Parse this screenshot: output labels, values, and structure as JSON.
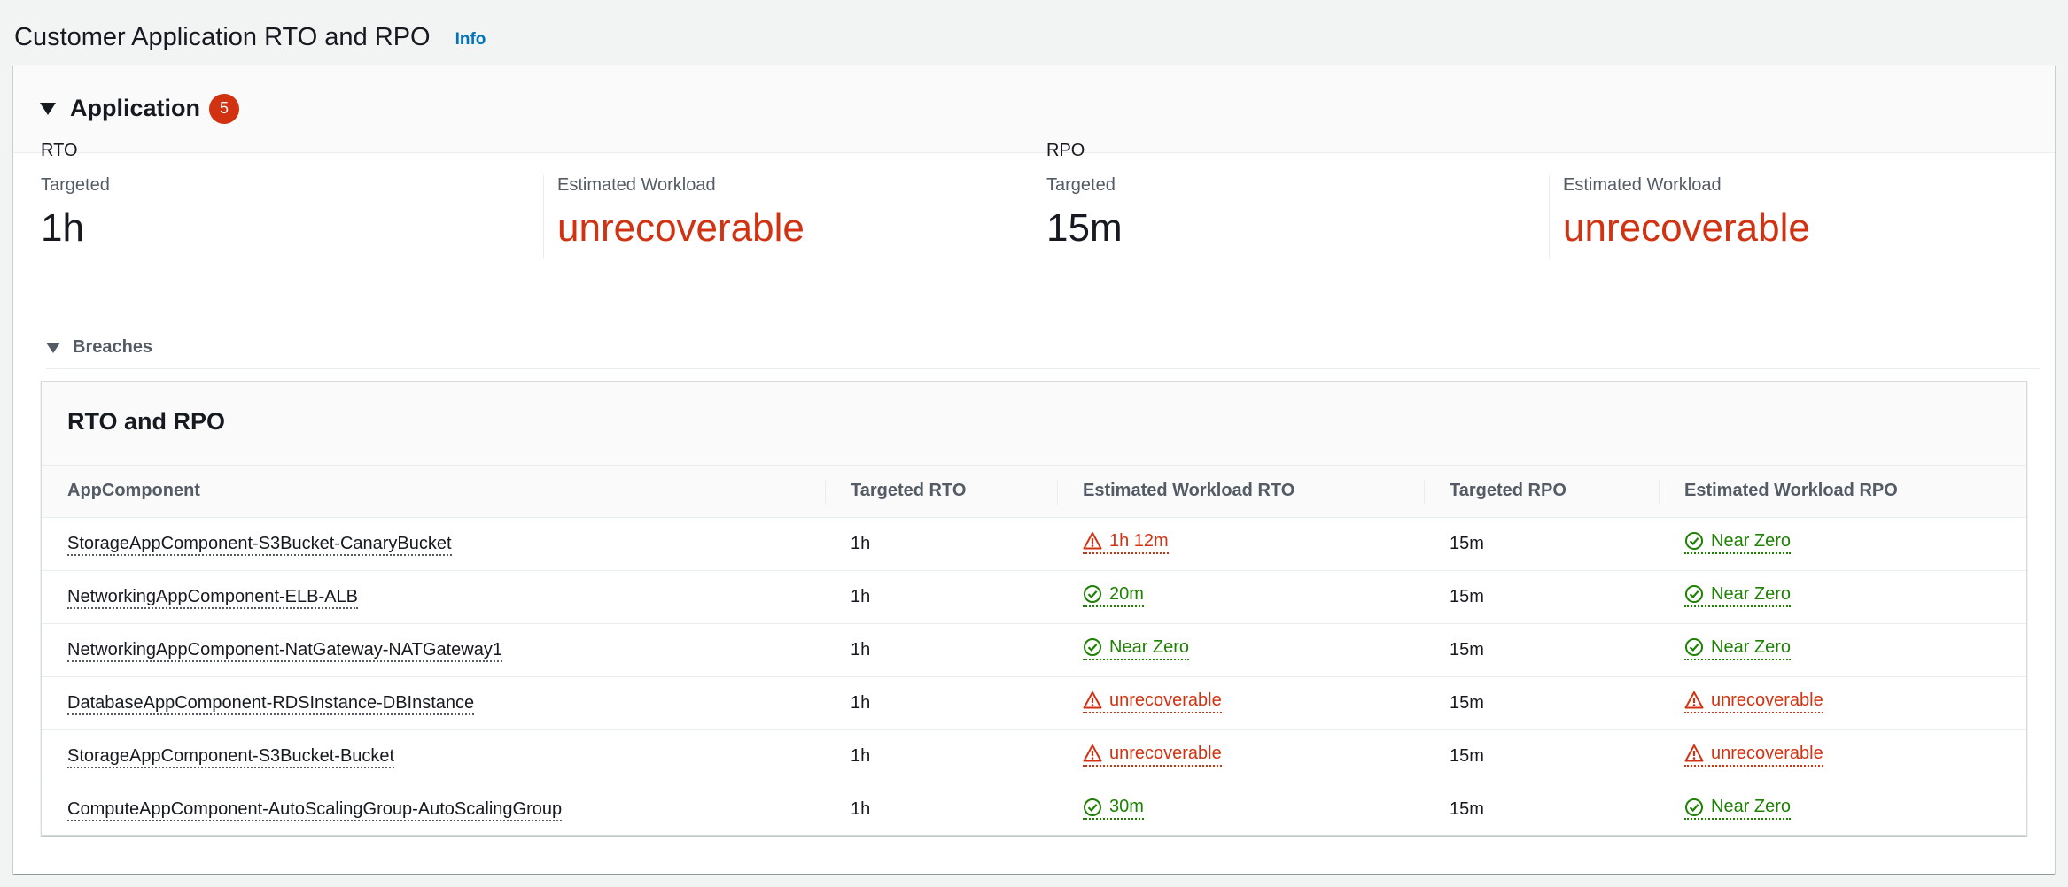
{
  "page": {
    "title": "Customer Application RTO and RPO",
    "info_label": "Info"
  },
  "application": {
    "title": "Application",
    "badge_count": "5"
  },
  "metrics": {
    "rto": {
      "group": "RTO",
      "targeted_label": "Targeted",
      "targeted_value": "1h",
      "estimated_label": "Estimated Workload",
      "estimated_value": "unrecoverable"
    },
    "rpo": {
      "group": "RPO",
      "targeted_label": "Targeted",
      "targeted_value": "15m",
      "estimated_label": "Estimated Workload",
      "estimated_value": "unrecoverable"
    }
  },
  "breaches": {
    "label": "Breaches",
    "table_title": "RTO and RPO",
    "columns": [
      "AppComponent",
      "Targeted RTO",
      "Estimated Workload RTO",
      "Targeted RPO",
      "Estimated Workload RPO"
    ],
    "rows": [
      {
        "component": "StorageAppComponent-S3Bucket-CanaryBucket",
        "targeted_rto": "1h",
        "est_rto": "1h 12m",
        "est_rto_status": "bad",
        "targeted_rpo": "15m",
        "est_rpo": "Near Zero",
        "est_rpo_status": "ok"
      },
      {
        "component": "NetworkingAppComponent-ELB-ALB",
        "targeted_rto": "1h",
        "est_rto": "20m",
        "est_rto_status": "ok",
        "targeted_rpo": "15m",
        "est_rpo": "Near Zero",
        "est_rpo_status": "ok"
      },
      {
        "component": "NetworkingAppComponent-NatGateway-NATGateway1",
        "targeted_rto": "1h",
        "est_rto": "Near Zero",
        "est_rto_status": "ok",
        "targeted_rpo": "15m",
        "est_rpo": "Near Zero",
        "est_rpo_status": "ok"
      },
      {
        "component": "DatabaseAppComponent-RDSInstance-DBInstance",
        "targeted_rto": "1h",
        "est_rto": "unrecoverable",
        "est_rto_status": "bad",
        "targeted_rpo": "15m",
        "est_rpo": "unrecoverable",
        "est_rpo_status": "bad"
      },
      {
        "component": "StorageAppComponent-S3Bucket-Bucket",
        "targeted_rto": "1h",
        "est_rto": "unrecoverable",
        "est_rto_status": "bad",
        "targeted_rpo": "15m",
        "est_rpo": "unrecoverable",
        "est_rpo_status": "bad"
      },
      {
        "component": "ComputeAppComponent-AutoScalingGroup-AutoScalingGroup",
        "targeted_rto": "1h",
        "est_rto": "30m",
        "est_rto_status": "ok",
        "targeted_rpo": "15m",
        "est_rpo": "Near Zero",
        "est_rpo_status": "ok"
      }
    ]
  },
  "colors": {
    "danger": "#d13212",
    "success": "#1d8102",
    "link": "#0073bb"
  },
  "icons": {
    "ok": "status-success-icon",
    "bad": "status-warning-icon"
  }
}
